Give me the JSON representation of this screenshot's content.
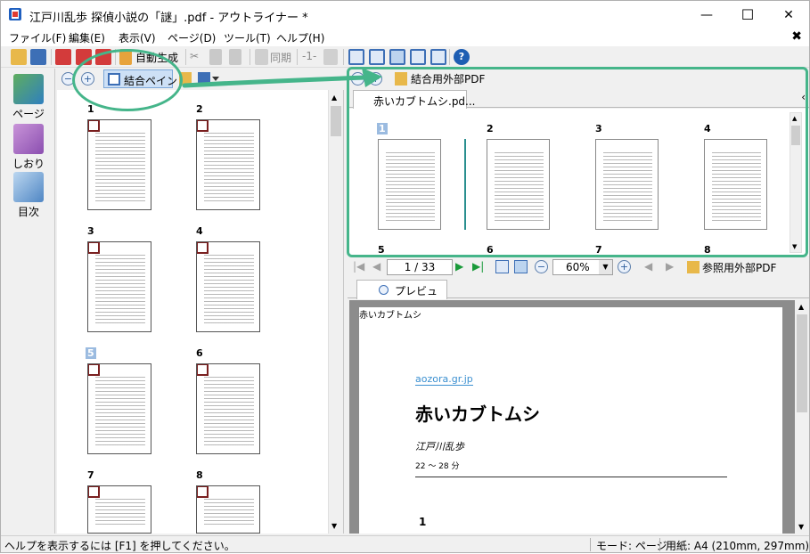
{
  "window": {
    "title": "江戸川乱歩 探偵小説の「謎」.pdf - アウトライナー *",
    "minimize": "—",
    "maximize": "☐",
    "close": "✕"
  },
  "menu": {
    "items": [
      "ファイル(F)",
      "編集(E)",
      "表示(V)",
      "ページ(D)",
      "ツール(T)",
      "ヘルプ(H)"
    ],
    "close_glyph": "✖"
  },
  "toolbar": {
    "auto_generate": "自動生成",
    "sync": "同期",
    "page_number": "-1-"
  },
  "left_strip": {
    "items": [
      {
        "label": "ページ",
        "icon": "pages-icon"
      },
      {
        "label": "しおり",
        "icon": "bookmark-icon"
      },
      {
        "label": "目次",
        "icon": "toc-icon"
      }
    ]
  },
  "page_panel": {
    "zoom_out": "−",
    "zoom_in": "+",
    "combine_pane_label": "結合ペイン",
    "thumbnails": [
      {
        "label": "1",
        "selected": false
      },
      {
        "label": "2",
        "selected": false
      },
      {
        "label": "3",
        "selected": false
      },
      {
        "label": "4",
        "selected": false
      },
      {
        "label": "5",
        "selected": true
      },
      {
        "label": "6",
        "selected": false
      },
      {
        "label": "7",
        "selected": false
      },
      {
        "label": "8",
        "selected": false
      }
    ]
  },
  "combined_panel": {
    "external_pdf_label": "結合用外部PDF",
    "tab_label": "赤いカブトムシ.pd...",
    "pages": [
      "1",
      "2",
      "3",
      "4",
      "5",
      "6",
      "7",
      "8"
    ]
  },
  "nav": {
    "page_display": "1 / 33",
    "zoom": "60%",
    "reference_pdf_label": "参照用外部PDF"
  },
  "preview": {
    "tab_label": "プレビュー",
    "running_header": "赤いカブトムシ",
    "link_text": "aozora.gr.jp",
    "doc_title": "赤いカブトムシ",
    "author": "江戸川乱歩",
    "meta": "22 ～ 28 分",
    "section_number": "1"
  },
  "status": {
    "help": "ヘルプを表示するには [F1] を押してください。",
    "mode": "モード: ページ",
    "paper": "用紙: A4 (210mm, 297mm)"
  },
  "colors": {
    "annotation_green": "#45b58a",
    "selection_blue": "#cde0f6",
    "link_blue": "#3a8fd0"
  }
}
